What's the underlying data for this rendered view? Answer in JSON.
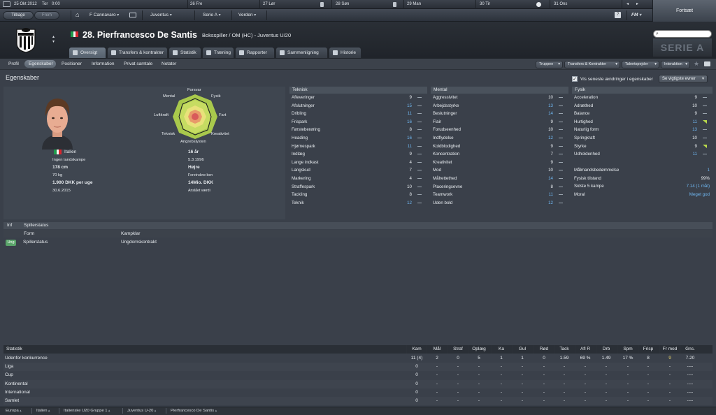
{
  "calendar": {
    "date": "25 Okt 2012",
    "day": "Tor",
    "time": "0:00",
    "days": [
      {
        "num": "26",
        "name": "Fre"
      },
      {
        "num": "27",
        "name": "Lør"
      },
      {
        "num": "28",
        "name": "Søn"
      },
      {
        "num": "29",
        "name": "Man"
      },
      {
        "num": "30",
        "name": "Tir"
      },
      {
        "num": "31",
        "name": "Ons"
      }
    ]
  },
  "nav": {
    "back": "Tilbage",
    "forward": "Frem",
    "manager": "F Cannavaro",
    "club": "Juventus",
    "league": "Serie A",
    "world": "Verden",
    "fm": "FM",
    "continue": "Fortsæt",
    "brand": "SERIE A"
  },
  "player": {
    "title": "28. Pierfrancesco De Santis",
    "subtitle": "Boksspiller / OM (HC) - Juventus U/20"
  },
  "tabs": [
    "Oversigt",
    "Transfers & kontrakter",
    "Statistik",
    "Træning",
    "Rapporter",
    "Sammenligning",
    "Historie"
  ],
  "subtabs": [
    "Profil",
    "Egenskaber",
    "Positioner",
    "Information",
    "Privat samtale",
    "Notater"
  ],
  "right_dropdowns": [
    "Truppen",
    "Transfers & Kontrakter",
    "Talentspejder",
    "Interaktion"
  ],
  "attributes_title": "Egenskaber",
  "show_changes_label": "Vis seneste ændringer i egenskaber",
  "key_attrs_label": "Se vigtigste evner",
  "radar": {
    "labels": {
      "forsvar": "Forsvar",
      "fysik": "Fysik",
      "fart": "Fart",
      "kreativitet": "Kreativitet",
      "angrebsfysten": "Angrebslysten",
      "teknisk": "Teknisk",
      "luftkraft": "Luftkraft",
      "mental": "Mental"
    }
  },
  "profile": {
    "nationality": "Italien",
    "caps": "Ingen landskampe",
    "height": "178 cm",
    "weight": "70 kg",
    "wage": "1.900 DKK per uge",
    "contract_end": "30.6.2015",
    "age": "16 år",
    "dob": "5.3.1996",
    "foot": "Højre",
    "foot_label": "Foretrukne ben",
    "value": "14Mio. DKK",
    "value_label": "Anslået værdi"
  },
  "teknisk": {
    "header": "Teknisk",
    "rows": [
      {
        "name": "Afleveringer",
        "value": "9",
        "hl": false
      },
      {
        "name": "Afslutninger",
        "value": "15",
        "hl": true
      },
      {
        "name": "Dribling",
        "value": "11",
        "hl": true
      },
      {
        "name": "Frispark",
        "value": "16",
        "hl": true
      },
      {
        "name": "Førsteberøring",
        "value": "8",
        "hl": false
      },
      {
        "name": "Heading",
        "value": "16",
        "hl": true
      },
      {
        "name": "Hjørnespark",
        "value": "11",
        "hl": true
      },
      {
        "name": "Indlæg",
        "value": "9",
        "hl": false
      },
      {
        "name": "Lange indkast",
        "value": "4",
        "hl": false
      },
      {
        "name": "Langskud",
        "value": "7",
        "hl": false
      },
      {
        "name": "Markering",
        "value": "4",
        "hl": false
      },
      {
        "name": "Straffespark",
        "value": "10",
        "hl": false
      },
      {
        "name": "Tackling",
        "value": "8",
        "hl": false
      },
      {
        "name": "Teknik",
        "value": "12",
        "hl": true
      }
    ]
  },
  "mental": {
    "header": "Mental",
    "rows": [
      {
        "name": "Aggressivitet",
        "value": "10",
        "hl": false
      },
      {
        "name": "Arbejdsstyrke",
        "value": "13",
        "hl": true
      },
      {
        "name": "Beslutninger",
        "value": "14",
        "hl": true
      },
      {
        "name": "Flair",
        "value": "9",
        "hl": false
      },
      {
        "name": "Forudseenhed",
        "value": "10",
        "hl": false
      },
      {
        "name": "Indflydelse",
        "value": "12",
        "hl": true
      },
      {
        "name": "Koldblodighed",
        "value": "9",
        "hl": false
      },
      {
        "name": "Koncentration",
        "value": "7",
        "hl": false
      },
      {
        "name": "Kreativitet",
        "value": "9",
        "hl": false
      },
      {
        "name": "Mod",
        "value": "10",
        "hl": false
      },
      {
        "name": "Målrettethed",
        "value": "14",
        "hl": true
      },
      {
        "name": "Placeringsevne",
        "value": "8",
        "hl": false
      },
      {
        "name": "Teamwork",
        "value": "11",
        "hl": true
      },
      {
        "name": "Uden bold",
        "value": "12",
        "hl": true
      }
    ]
  },
  "fysik": {
    "header": "Fysik",
    "rows": [
      {
        "name": "Acceleration",
        "value": "9",
        "hl": false,
        "trend": "dash"
      },
      {
        "name": "Adræthed",
        "value": "10",
        "hl": false,
        "trend": "dash"
      },
      {
        "name": "Balance",
        "value": "9",
        "hl": false,
        "trend": "dash"
      },
      {
        "name": "Hurtighed",
        "value": "11",
        "hl": true,
        "trend": "up"
      },
      {
        "name": "Naturlig form",
        "value": "13",
        "hl": true,
        "trend": "dash"
      },
      {
        "name": "Springkraft",
        "value": "10",
        "hl": false,
        "trend": "dash"
      },
      {
        "name": "Styrke",
        "value": "9",
        "hl": false,
        "trend": "up"
      },
      {
        "name": "Udholdenhed",
        "value": "11",
        "hl": true,
        "trend": "dash"
      }
    ],
    "extra": [
      {
        "name": "Målmandsbedømmelse",
        "value": "1"
      },
      {
        "name": "Fysisk tilstand",
        "value": "99%"
      },
      {
        "name": "Sidste 5 kampe",
        "value": "7.14 (1 måt)"
      },
      {
        "name": "Moral",
        "value": "Meget god"
      }
    ]
  },
  "info": {
    "col1": "Inf",
    "col2": "Spillerstatus",
    "form_label": "Form",
    "form_value": "Kampklar",
    "badge": "Ung",
    "status_label": "Spillerstatus",
    "status_value": "Ungdomskontrakt"
  },
  "stats": {
    "title": "Statistik",
    "columns": [
      "Kam",
      "Mål",
      "Straf",
      "Oplæg",
      "Ka",
      "Gul",
      "Rød",
      "Tack",
      "Afl R",
      "Drb",
      "Spm",
      "Frisp",
      "Fr mod",
      "Gns."
    ],
    "rows": [
      {
        "name": "Udenfor konkurrence",
        "values": [
          "11 (4)",
          "2",
          "0",
          "5",
          "1",
          "1",
          "0",
          "1.59",
          "69 %",
          "1.49",
          "17 %",
          "8",
          "9",
          "7.20"
        ]
      },
      {
        "name": "Liga",
        "values": [
          "0",
          "-",
          "-",
          "-",
          "-",
          "-",
          "-",
          "-",
          "-",
          "-",
          "-",
          "-",
          "-",
          "----"
        ]
      },
      {
        "name": "Cup",
        "values": [
          "0",
          "-",
          "-",
          "-",
          "-",
          "-",
          "-",
          "-",
          "-",
          "-",
          "-",
          "-",
          "-",
          "----"
        ]
      },
      {
        "name": "Kontinental",
        "values": [
          "0",
          "-",
          "-",
          "-",
          "-",
          "-",
          "-",
          "-",
          "-",
          "-",
          "-",
          "-",
          "-",
          "----"
        ]
      },
      {
        "name": "International",
        "values": [
          "0",
          "-",
          "-",
          "-",
          "-",
          "-",
          "-",
          "-",
          "-",
          "-",
          "-",
          "-",
          "-",
          "----"
        ]
      },
      {
        "name": "Samlet",
        "values": [
          "0",
          "-",
          "-",
          "-",
          "-",
          "-",
          "-",
          "-",
          "-",
          "-",
          "-",
          "-",
          "-",
          "----"
        ]
      }
    ]
  },
  "breadcrumbs": [
    "Europa",
    "Italien",
    "Italienske U20 Gruppe 1",
    "Juventus U-20",
    "Pierfrancesco De Santis"
  ],
  "colors": {
    "highlight_value": "#6fb6f0",
    "trend_up": "#b8d84a",
    "badge_green": "#5aa46a"
  }
}
